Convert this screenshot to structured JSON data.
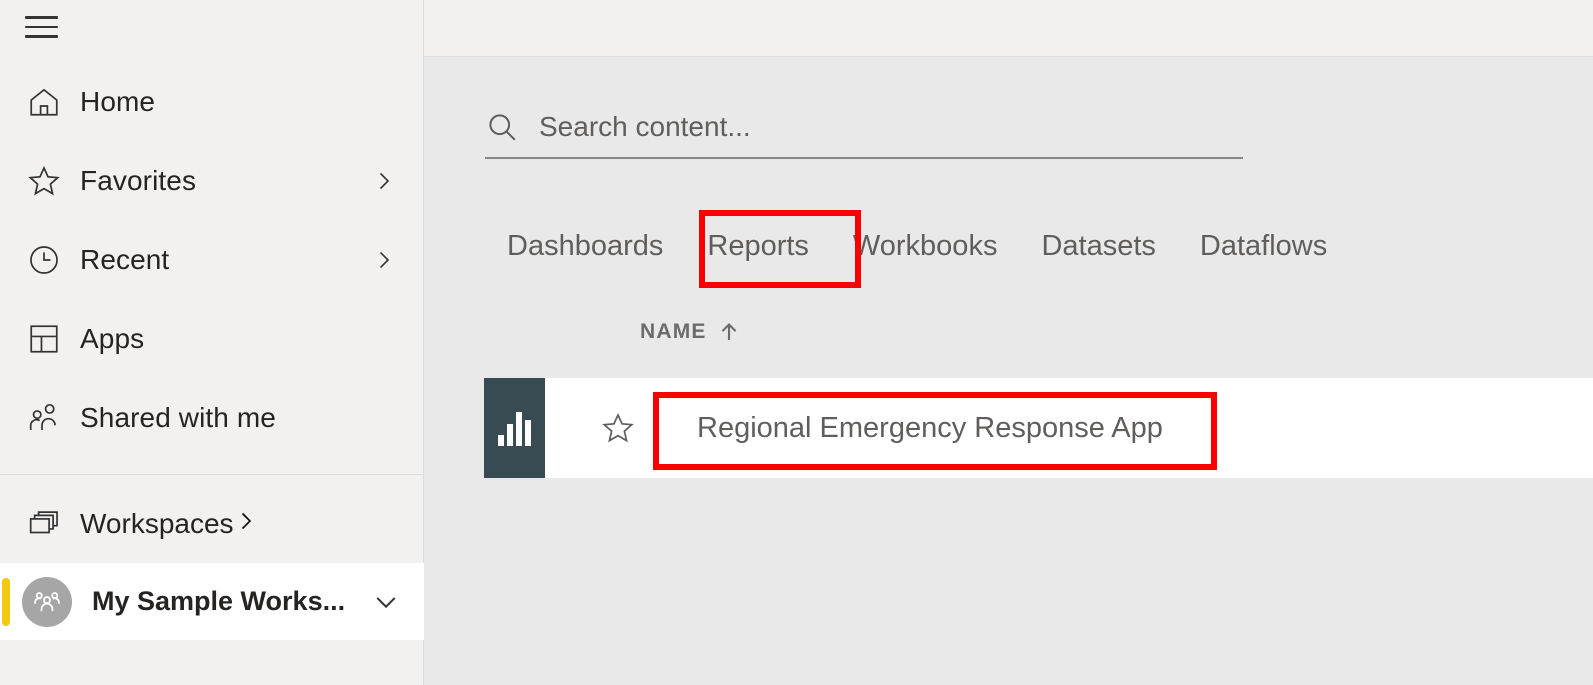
{
  "app": {
    "accent_yellow": "#f2c811",
    "highlight_red": "#fc0000",
    "thumb_dark": "#384a52"
  },
  "sidebar": {
    "menu_icon": "hamburger-icon",
    "items": [
      {
        "label": "Home",
        "icon": "home-icon",
        "chevron": false
      },
      {
        "label": "Favorites",
        "icon": "star-icon",
        "chevron": true
      },
      {
        "label": "Recent",
        "icon": "clock-icon",
        "chevron": true
      },
      {
        "label": "Apps",
        "icon": "apps-grid-icon",
        "chevron": false
      },
      {
        "label": "Shared with me",
        "icon": "people-icon",
        "chevron": false
      }
    ],
    "workspaces": {
      "label": "Workspaces",
      "icon": "workspaces-stack-icon",
      "chevron": true
    },
    "current_workspace": {
      "label": "My Sample Works...",
      "icon": "group-avatar-icon",
      "chevron": "chevron-down-icon",
      "selected": true
    }
  },
  "search": {
    "placeholder": "Search content...",
    "value": "",
    "icon": "search-icon"
  },
  "tabs": [
    {
      "label": "Dashboards",
      "selected": false
    },
    {
      "label": "Reports",
      "selected": true
    },
    {
      "label": "Workbooks",
      "selected": false
    },
    {
      "label": "Datasets",
      "selected": false
    },
    {
      "label": "Dataflows",
      "selected": false
    }
  ],
  "table": {
    "columns": [
      {
        "label": "NAME",
        "sort": "ascending",
        "sort_icon": "arrow-up-icon"
      }
    ],
    "rows": [
      {
        "name": "Regional Emergency Response App",
        "type_icon": "report-bar-chart-icon",
        "favorite_icon": "star-outline-icon",
        "favorited": false
      }
    ]
  }
}
